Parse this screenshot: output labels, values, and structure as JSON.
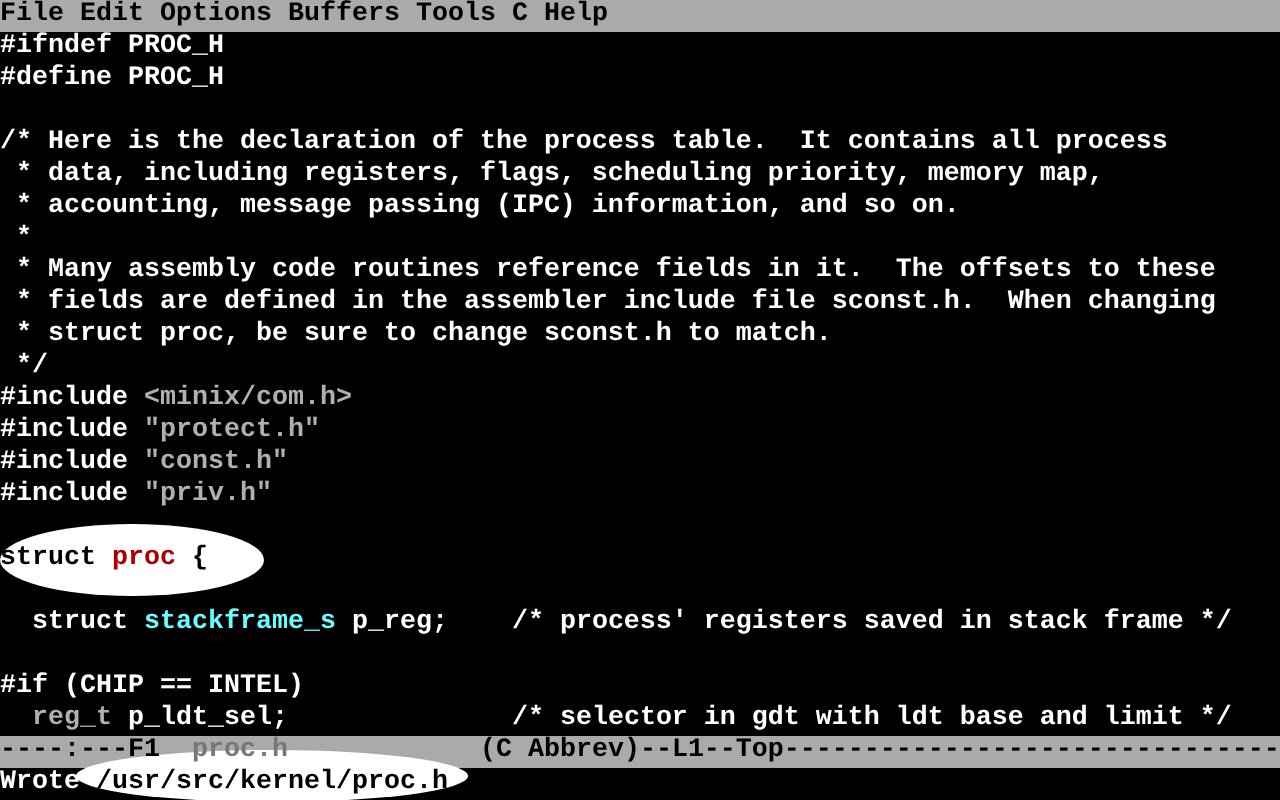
{
  "menu_bar": {
    "items": [
      "File",
      "Edit",
      "Options",
      "Buffers",
      "Tools",
      "C",
      "Help"
    ]
  },
  "buffer": {
    "lines": [
      {
        "kind": "code",
        "highlighted": false,
        "segments": [
          {
            "kind": "plain",
            "text": "#ifndef PROC_H"
          }
        ]
      },
      {
        "kind": "code",
        "highlighted": false,
        "segments": [
          {
            "kind": "plain",
            "text": "#define PROC_H"
          }
        ]
      },
      {
        "kind": "blank"
      },
      {
        "kind": "code",
        "highlighted": false,
        "segments": [
          {
            "kind": "plain",
            "text": "/* Here is the declaration of the process table.  It contains all process"
          }
        ]
      },
      {
        "kind": "code",
        "highlighted": false,
        "segments": [
          {
            "kind": "plain",
            "text": " * data, including registers, flags, scheduling priority, memory map,"
          }
        ]
      },
      {
        "kind": "code",
        "highlighted": false,
        "segments": [
          {
            "kind": "plain",
            "text": " * accounting, message passing (IPC) information, and so on."
          }
        ]
      },
      {
        "kind": "code",
        "highlighted": false,
        "segments": [
          {
            "kind": "plain",
            "text": " *"
          }
        ]
      },
      {
        "kind": "code",
        "highlighted": false,
        "segments": [
          {
            "kind": "plain",
            "text": " * Many assembly code routines reference fields in it.  The offsets to these"
          }
        ]
      },
      {
        "kind": "code",
        "highlighted": false,
        "segments": [
          {
            "kind": "plain",
            "text": " * fields are defined in the assembler include file sconst.h.  When changing"
          }
        ]
      },
      {
        "kind": "code",
        "highlighted": false,
        "segments": [
          {
            "kind": "plain",
            "text": " * struct proc, be sure to change sconst.h to match."
          }
        ]
      },
      {
        "kind": "code",
        "highlighted": false,
        "segments": [
          {
            "kind": "plain",
            "text": " */"
          }
        ]
      },
      {
        "kind": "code",
        "highlighted": false,
        "segments": [
          {
            "kind": "plain",
            "text": "#include "
          },
          {
            "kind": "string",
            "text": "<minix/com.h>"
          }
        ]
      },
      {
        "kind": "code",
        "highlighted": false,
        "segments": [
          {
            "kind": "plain",
            "text": "#include "
          },
          {
            "kind": "string",
            "text": "\"protect.h\""
          }
        ]
      },
      {
        "kind": "code",
        "highlighted": false,
        "segments": [
          {
            "kind": "plain",
            "text": "#include "
          },
          {
            "kind": "string",
            "text": "\"const.h\""
          }
        ]
      },
      {
        "kind": "code",
        "highlighted": false,
        "segments": [
          {
            "kind": "plain",
            "text": "#include "
          },
          {
            "kind": "string",
            "text": "\"priv.h\""
          }
        ]
      },
      {
        "kind": "blank"
      },
      {
        "kind": "code",
        "highlighted": true,
        "segments": [
          {
            "kind": "plain",
            "text": "struct "
          },
          {
            "kind": "name",
            "text": "proc"
          },
          {
            "kind": "plain",
            "text": " {"
          }
        ]
      },
      {
        "kind": "blank"
      },
      {
        "kind": "code",
        "highlighted": false,
        "segments": [
          {
            "kind": "plain",
            "text": "  struct "
          },
          {
            "kind": "type",
            "text": "stackframe_s"
          },
          {
            "kind": "plain",
            "text": " p_reg;    /* process' registers saved in stack frame */"
          }
        ]
      },
      {
        "kind": "blank"
      },
      {
        "kind": "code",
        "highlighted": false,
        "segments": [
          {
            "kind": "plain",
            "text": "#if (CHIP == INTEL)"
          }
        ]
      },
      {
        "kind": "code",
        "highlighted": false,
        "segments": [
          {
            "kind": "string",
            "text": "  reg_t"
          },
          {
            "kind": "plain",
            "text": " p_ldt_sel;              /* selector in gdt with ldt base and limit */"
          }
        ]
      }
    ]
  },
  "mode_line": {
    "segments": [
      {
        "kind": "plain",
        "text": "----:---F1  "
      },
      {
        "kind": "string",
        "text": "proc.h"
      },
      {
        "kind": "plain",
        "text": "            (C Abbrev)--L1--Top-------------------------------"
      }
    ]
  },
  "minibuffer": {
    "label": "Wrote ",
    "path": "/usr/src/kernel/proc.h",
    "highlighted": true
  }
}
